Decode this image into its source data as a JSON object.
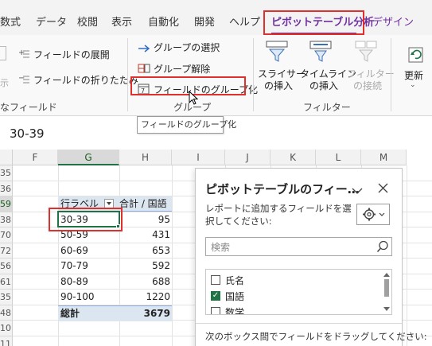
{
  "ribbon_tabs": [
    "数式",
    "データ",
    "校閲",
    "表示",
    "自動化",
    "開発",
    "ヘルプ",
    "ピボットテーブル分析",
    "デザイン"
  ],
  "active_tab": "ピボットテーブル分析",
  "ribbon": {
    "expand_field": "フィールドの展開",
    "collapse_field": "フィールドの折りたたみ",
    "active_field_group": "なフィールド",
    "gray_fragment": "示",
    "group_selection": "グループの選択",
    "ungroup": "グループ解除",
    "group_field": "フィールドのグループ化",
    "group_label": "グループ",
    "slicer_l1": "スライサー",
    "slicer_l2": "の挿入",
    "timeline_l1": "タイムライン",
    "timeline_l2": "の挿入",
    "filter_conn_l1": "フィルター",
    "filter_conn_l2": "の接続",
    "filter_label": "フィルター",
    "refresh": "更新"
  },
  "tooltip": "フィールドのグループ化",
  "formula_value": "30-39",
  "columns": [
    "F",
    "G",
    "H",
    "I",
    "J",
    "K",
    "L",
    "M"
  ],
  "rows": [
    "35",
    "36",
    "59",
    "38",
    "70",
    "72",
    "56",
    "61",
    "35",
    "48",
    "10",
    "11"
  ],
  "pivot": {
    "header_label": "行ラベル",
    "header_value": "合計 / 国語",
    "items": [
      {
        "label": "30-39",
        "value": "95"
      },
      {
        "label": "50-59",
        "value": "431"
      },
      {
        "label": "60-69",
        "value": "653"
      },
      {
        "label": "70-79",
        "value": "592"
      },
      {
        "label": "80-89",
        "value": "688"
      },
      {
        "label": "90-100",
        "value": "1220"
      }
    ],
    "total_label": "総計",
    "total_value": "3679"
  },
  "pane": {
    "title": "ピボットテーブルのフィー…",
    "subtitle": "レポートに追加するフィールドを選択してください:",
    "search_placeholder": "検索",
    "fields": [
      {
        "name": "氏名",
        "checked": false
      },
      {
        "name": "国語",
        "checked": true
      },
      {
        "name": "数学",
        "checked": false
      }
    ],
    "footer": "次のボックス間でフィールドをドラッグしてください:"
  },
  "colors": {
    "accent": "#7030a0",
    "excel_green": "#217346",
    "highlight_red": "#e0302e",
    "pivot_header": "#dce6f1"
  }
}
